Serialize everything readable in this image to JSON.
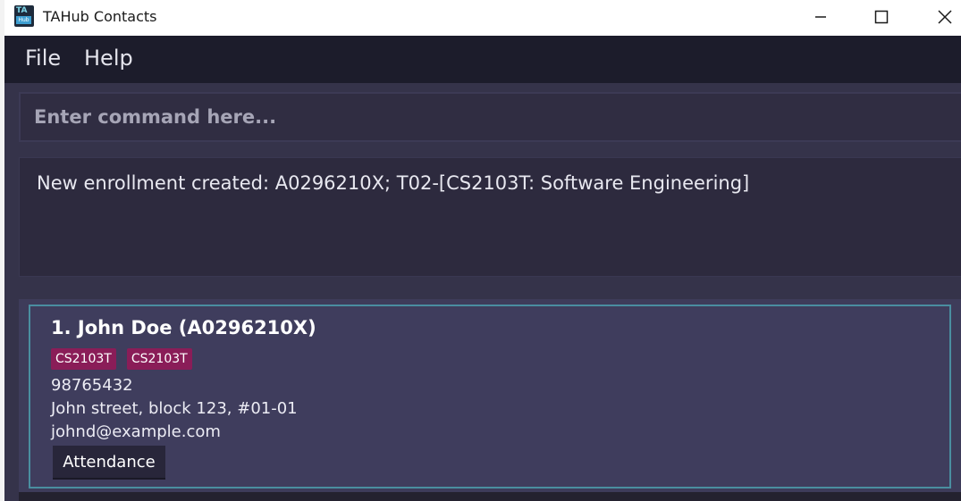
{
  "window": {
    "title": "TAHub Contacts",
    "icon_top": "TA",
    "icon_bottom": "Hub"
  },
  "menu": {
    "items": [
      {
        "label": "File"
      },
      {
        "label": "Help"
      }
    ]
  },
  "command": {
    "placeholder": "Enter command here...",
    "value": ""
  },
  "result": {
    "message": "New enrollment created: A0296210X; T02-[CS2103T: Software Engineering]"
  },
  "persons": [
    {
      "index_name": "1.  John Doe (A0296210X)",
      "tags": [
        "CS2103T",
        "CS2103T"
      ],
      "phone": "98765432",
      "address": "John street, block 123, #01-01",
      "email": "johnd@example.com",
      "attendance_label": "Attendance"
    }
  ],
  "colors": {
    "menubar": "#1c1c2b",
    "main_bg": "#35334a",
    "card_border": "#4a8ea0",
    "tag_bg": "#8a1d58"
  },
  "icons": {
    "minimize": "minimize-icon",
    "maximize": "maximize-icon",
    "close": "close-icon"
  }
}
